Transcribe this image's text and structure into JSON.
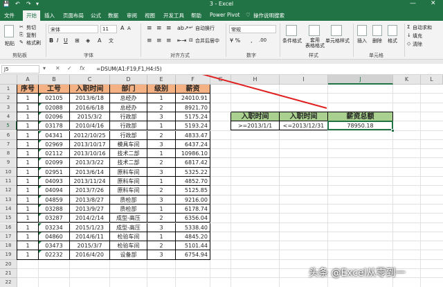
{
  "title_bar": {
    "title": "3 - Excel"
  },
  "menu": {
    "tabs": [
      "文件",
      "开始",
      "插入",
      "页面布局",
      "公式",
      "数据",
      "审阅",
      "视图",
      "开发工具",
      "帮助",
      "Power Pivot",
      "操作说明搜索"
    ],
    "active_index": 1
  },
  "ribbon": {
    "clipboard": {
      "paste": "粘贴",
      "cut": "剪切",
      "copy": "复制",
      "format_painter": "格式刷",
      "group": "剪贴板"
    },
    "font": {
      "name": "宋体",
      "size": "11",
      "group": "字体"
    },
    "alignment": {
      "wrap": "自动换行",
      "merge": "合并后居中",
      "group": "对齐方式"
    },
    "number": {
      "format": "常规",
      "group": "数字"
    },
    "styles": {
      "conditional": "条件格式",
      "table": "套用\n表格格式",
      "cell_styles": "单元格样式",
      "group": "样式"
    },
    "cells": {
      "insert": "插入",
      "delete": "删除",
      "format": "格式",
      "group": "单元格"
    },
    "editing": {
      "autosum": "自动求和",
      "fill": "填充",
      "clear": "清除"
    }
  },
  "formula_bar": {
    "name_box": "J5",
    "formula": "=DSUM(A1:F19,F1,H4:I5)"
  },
  "columns": [
    "A",
    "B",
    "C",
    "D",
    "E",
    "F",
    "G",
    "H",
    "I",
    "J",
    "K",
    "L"
  ],
  "selected": {
    "column": "J",
    "row": 5
  },
  "row_numbers": [
    1,
    2,
    3,
    4,
    5,
    6,
    7,
    8,
    9,
    10,
    11,
    12,
    13,
    14,
    15,
    16,
    17,
    18,
    19,
    20,
    21,
    22,
    23
  ],
  "table": {
    "headers": [
      "序号",
      "工号",
      "入职时间",
      "部门",
      "级别",
      "薪资"
    ],
    "rows": [
      [
        "1",
        "02105",
        "2013/6/18",
        "总经办",
        "1",
        "24010.91"
      ],
      [
        "1",
        "02088",
        "2016/6/18",
        "总经办",
        "2",
        "8921.70"
      ],
      [
        "1",
        "02096",
        "2015/3/2",
        "行政部",
        "3",
        "5175.24"
      ],
      [
        "1",
        "03178",
        "2010/4/16",
        "行政部",
        "1",
        "5193.24"
      ],
      [
        "1",
        "04341",
        "2012/10/25",
        "行政部",
        "2",
        "4833.47"
      ],
      [
        "1",
        "02969",
        "2013/10/17",
        "模具车间",
        "3",
        "6437.24"
      ],
      [
        "1",
        "02112",
        "2013/10/16",
        "技术二部",
        "1",
        "10986.10"
      ],
      [
        "1",
        "02099",
        "2013/3/22",
        "技术二部",
        "2",
        "6817.42"
      ],
      [
        "1",
        "02951",
        "2013/6/14",
        "原料车间",
        "3",
        "5325.22"
      ],
      [
        "1",
        "04093",
        "2013/11/24",
        "原料车间",
        "1",
        "4852.70"
      ],
      [
        "1",
        "04094",
        "2013/7/26",
        "原料车间",
        "2",
        "5125.85"
      ],
      [
        "1",
        "04859",
        "2013/8/27",
        "质检部",
        "3",
        "9216.00"
      ],
      [
        "1",
        "03288",
        "2013/9/27",
        "质检部",
        "1",
        "6178.74"
      ],
      [
        "1",
        "03287",
        "2014/2/14",
        "成型-高压",
        "2",
        "6356.04"
      ],
      [
        "1",
        "03234",
        "2015/1/23",
        "成型-高压",
        "3",
        "5338.40"
      ],
      [
        "1",
        "04860",
        "2014/6/11",
        "检验车间",
        "1",
        "4845.20"
      ],
      [
        "1",
        "03473",
        "2015/3/7",
        "检验车间",
        "2",
        "5101.44"
      ],
      [
        "1",
        "02232",
        "2016/4/20",
        "设备部",
        "3",
        "6754.94"
      ]
    ]
  },
  "criteria": {
    "headers": [
      "入职时间",
      "入职时间",
      "薪资总额"
    ],
    "values": [
      ">=2013/1/1",
      "<=2013/12/31",
      "78950.18"
    ]
  },
  "watermark": "头条 @Excel从零到一"
}
